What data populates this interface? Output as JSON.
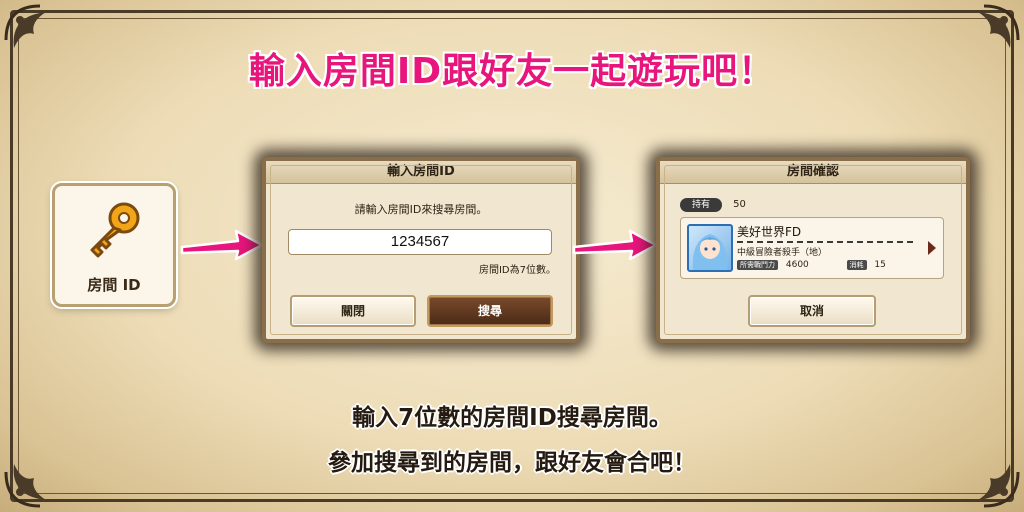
{
  "headline": "輸入房間ID跟好友一起遊玩吧！",
  "key_tile": {
    "label": "房間 ID",
    "icon": "key-icon"
  },
  "input_panel": {
    "title": "輸入房間ID",
    "prompt": "請輸入房間ID來搜尋房間。",
    "input_value": "1234567",
    "hint": "房間ID為7位數。",
    "close_label": "關閉",
    "search_label": "搜尋"
  },
  "confirm_panel": {
    "title": "房間確認",
    "have_badge": "持有",
    "have_value": "50",
    "room_name": "美好世界FD",
    "rank": "中級冒險者殺手（地）",
    "stat1_label": "所需戰鬥力",
    "stat1_value": "4600",
    "stat2_label": "消耗",
    "stat2_value": "15",
    "cancel_label": "取消"
  },
  "bottom_text": {
    "line1": "輸入7位數的房間ID搜尋房間。",
    "line2": "參加搜尋到的房間，跟好友會合吧！"
  },
  "colors": {
    "headline": "#e8157c",
    "arrow": "#e8157c",
    "panel_border": "#8a6e4a",
    "search_button": "#5a341c"
  }
}
